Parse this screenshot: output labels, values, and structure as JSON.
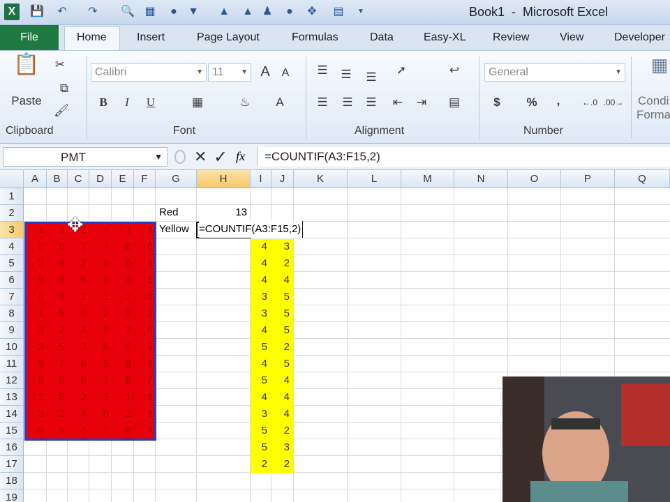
{
  "window": {
    "title": "Book1  -  Microsoft Excel"
  },
  "ribbon_tabs": [
    "File",
    "Home",
    "Insert",
    "Page Layout",
    "Formulas",
    "Data",
    "Easy-XL",
    "Review",
    "View",
    "Developer"
  ],
  "ribbon": {
    "clipboard": {
      "paste_label": "Paste",
      "group_label": "Clipboard"
    },
    "font": {
      "font_name": "Calibri",
      "font_size": "11",
      "bold": "B",
      "italic": "I",
      "underline": "U",
      "group_label": "Font"
    },
    "alignment": {
      "group_label": "Alignment"
    },
    "number": {
      "format": "General",
      "currency": "$",
      "percent": "%",
      "comma": ",",
      "group_label": "Number"
    },
    "styles": {
      "conditional_label_1": "Condi",
      "conditional_label_2": "Forma"
    }
  },
  "formula_bar": {
    "name_box": "PMT",
    "fx": "fx",
    "formula": "=COUNTIF(A3:F15,2)"
  },
  "columns": [
    "A",
    "B",
    "C",
    "D",
    "E",
    "F",
    "G",
    "H",
    "I",
    "J",
    "K",
    "L",
    "M",
    "N",
    "O",
    "P",
    "Q"
  ],
  "rows": [
    "1",
    "2",
    "3",
    "4",
    "5",
    "6",
    "7",
    "8",
    "9",
    "10",
    "11",
    "12",
    "13",
    "14",
    "15",
    "16",
    "17",
    "18",
    "19"
  ],
  "cells": {
    "G2": "Red",
    "H2": "13",
    "G3": "Yellow",
    "H3": "=COUNTIF(A3:F15,2)"
  },
  "red_range_values": [
    [
      "1",
      "3",
      "3",
      "4",
      "3",
      "3"
    ],
    [
      "2",
      "6",
      "7",
      "4",
      "8",
      "6"
    ],
    [
      "2",
      "8",
      "2",
      "6",
      "6",
      "9"
    ],
    [
      "9",
      "8",
      "6",
      "9",
      "5",
      "1"
    ],
    [
      "5",
      "9",
      "2",
      "1",
      "2",
      "8"
    ],
    [
      "1",
      "5",
      "9",
      "2",
      "8",
      "2"
    ],
    [
      "3",
      "2",
      "4",
      "5",
      "3",
      "6"
    ],
    [
      "3",
      "5",
      "3",
      "6",
      "6",
      "9"
    ],
    [
      "9",
      "7",
      "8",
      "5",
      "8",
      "6"
    ],
    [
      "5",
      "8",
      "8",
      "2",
      "8",
      "7"
    ],
    [
      "2",
      "5",
      "2",
      "3",
      "1",
      "8"
    ],
    [
      "3",
      "2",
      "4",
      "6",
      "2",
      "9"
    ],
    [
      "9",
      "5",
      "4",
      "5",
      "8",
      "7"
    ]
  ],
  "yellow_range_values": [
    [
      "4",
      "3"
    ],
    [
      "4",
      "2"
    ],
    [
      "4",
      "4"
    ],
    [
      "3",
      "5"
    ],
    [
      "3",
      "5"
    ],
    [
      "4",
      "5"
    ],
    [
      "5",
      "2"
    ],
    [
      "4",
      "5"
    ],
    [
      "5",
      "4"
    ],
    [
      "4",
      "4"
    ],
    [
      "3",
      "4"
    ],
    [
      "5",
      "2"
    ],
    [
      "5",
      "3"
    ],
    [
      "2",
      "2"
    ]
  ],
  "colors": {
    "red_fill": "#e8000b",
    "yellow_fill": "#ffff00",
    "selection": "#1f3fc8",
    "file_tab": "#1f7a41"
  }
}
